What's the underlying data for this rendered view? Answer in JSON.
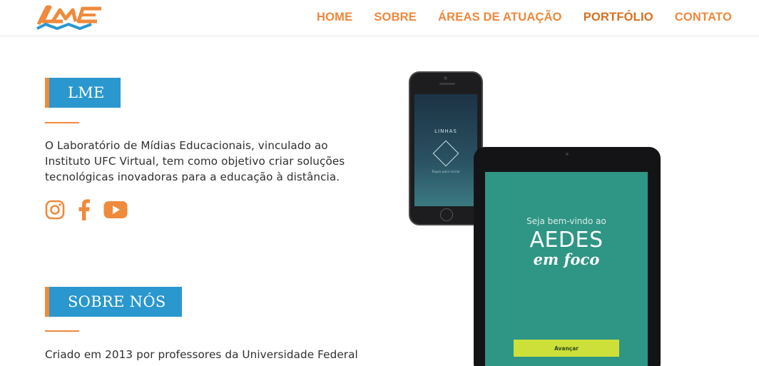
{
  "header": {
    "logo_text": "LME",
    "nav": [
      {
        "label": "HOME"
      },
      {
        "label": "SOBRE"
      },
      {
        "label": "ÁREAS DE ATUAÇÃO"
      },
      {
        "label": "PORTFÓLIO"
      },
      {
        "label": "CONTATO"
      }
    ]
  },
  "intro": {
    "heading": "LME",
    "text_lines": [
      "O Laboratório de Mídias Educacionais, vinculado ao",
      "Instituto UFC Virtual, tem como objetivo criar soluções",
      "tecnológicas inovadoras para a educação à distância."
    ]
  },
  "social": {
    "icons": [
      "instagram-icon",
      "facebook-icon",
      "youtube-icon"
    ],
    "color": "#f08a3c"
  },
  "about": {
    "heading": "SOBRE NÓS",
    "text_line": "Criado em 2013 por professores da Universidade Federal"
  },
  "phone_app": {
    "title": "LINHAS",
    "tap_text": "Toque para iniciar"
  },
  "tablet_app": {
    "welcome": "Seja bem-vindo ao",
    "brand_line1": "AEDES",
    "brand_line2": "em foco",
    "button_label": "Avançar"
  },
  "colors": {
    "accent_orange": "#f08a3c",
    "label_blue": "#2a97cf",
    "tablet_screen": "#2f9584",
    "button_lime": "#cde03a"
  }
}
